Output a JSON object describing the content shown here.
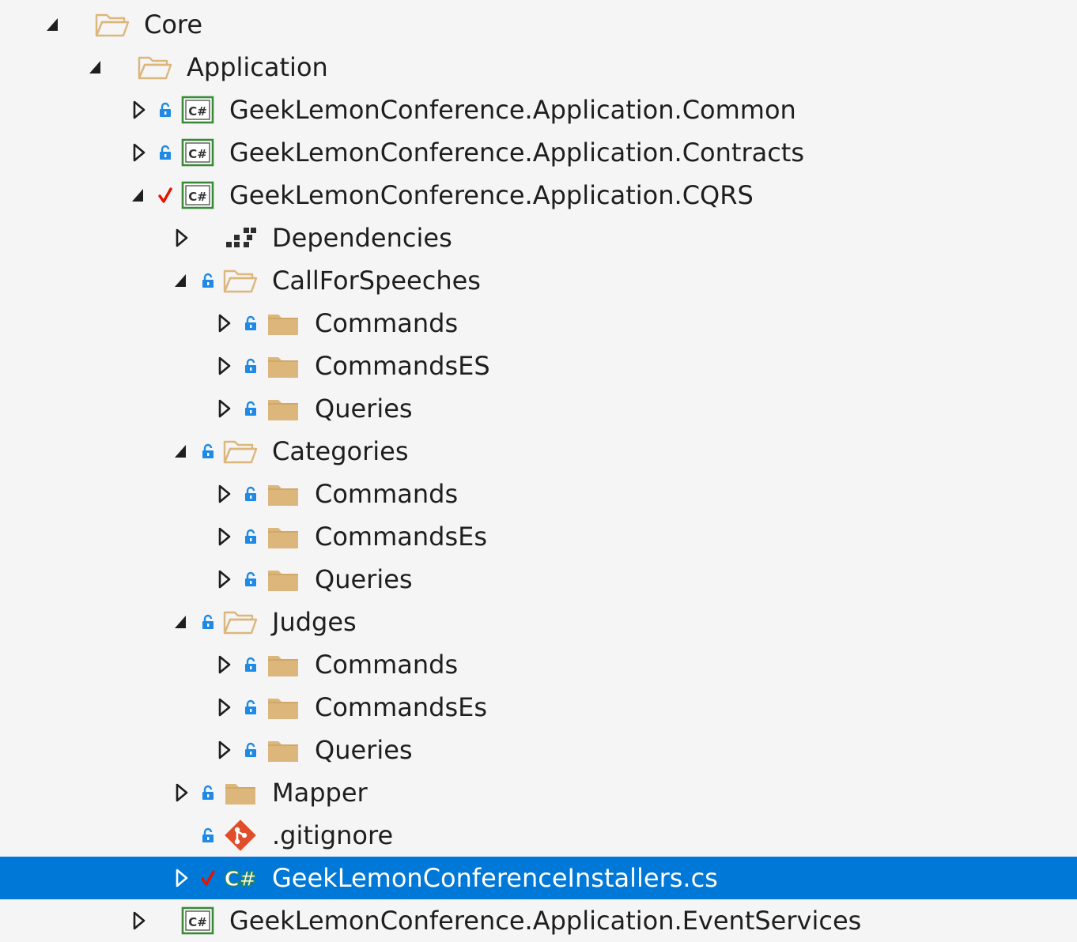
{
  "solution_explorer": {
    "rows": [
      {
        "label": "Core",
        "level": 0,
        "expander": "expanded",
        "status": "none",
        "icon": "folder-open-icon"
      },
      {
        "label": "Application",
        "level": 1,
        "expander": "expanded",
        "status": "none",
        "icon": "folder-open-icon"
      },
      {
        "label": "GeekLemonConference.Application.Common",
        "level": 2,
        "expander": "collapsed",
        "status": "lock",
        "icon": "csharp-project-icon"
      },
      {
        "label": "GeekLemonConference.Application.Contracts",
        "level": 2,
        "expander": "collapsed",
        "status": "lock",
        "icon": "csharp-project-icon"
      },
      {
        "label": "GeekLemonConference.Application.CQRS",
        "level": 2,
        "expander": "expanded",
        "status": "check",
        "icon": "csharp-project-icon"
      },
      {
        "label": "Dependencies",
        "level": 3,
        "expander": "collapsed",
        "status": "none",
        "icon": "dependencies-icon"
      },
      {
        "label": "CallForSpeeches",
        "level": 3,
        "expander": "expanded",
        "status": "lock",
        "icon": "folder-open-icon"
      },
      {
        "label": "Commands",
        "level": 4,
        "expander": "collapsed",
        "status": "lock",
        "icon": "folder-icon"
      },
      {
        "label": "CommandsES",
        "level": 4,
        "expander": "collapsed",
        "status": "lock",
        "icon": "folder-icon"
      },
      {
        "label": "Queries",
        "level": 4,
        "expander": "collapsed",
        "status": "lock",
        "icon": "folder-icon"
      },
      {
        "label": "Categories",
        "level": 3,
        "expander": "expanded",
        "status": "lock",
        "icon": "folder-open-icon"
      },
      {
        "label": "Commands",
        "level": 4,
        "expander": "collapsed",
        "status": "lock",
        "icon": "folder-icon"
      },
      {
        "label": "CommandsEs",
        "level": 4,
        "expander": "collapsed",
        "status": "lock",
        "icon": "folder-icon"
      },
      {
        "label": "Queries",
        "level": 4,
        "expander": "collapsed",
        "status": "lock",
        "icon": "folder-icon"
      },
      {
        "label": "Judges",
        "level": 3,
        "expander": "expanded",
        "status": "lock",
        "icon": "folder-open-icon"
      },
      {
        "label": "Commands",
        "level": 4,
        "expander": "collapsed",
        "status": "lock",
        "icon": "folder-icon"
      },
      {
        "label": "CommandsEs",
        "level": 4,
        "expander": "collapsed",
        "status": "lock",
        "icon": "folder-icon"
      },
      {
        "label": "Queries",
        "level": 4,
        "expander": "collapsed",
        "status": "lock",
        "icon": "folder-icon"
      },
      {
        "label": "Mapper",
        "level": 3,
        "expander": "collapsed",
        "status": "lock",
        "icon": "folder-icon"
      },
      {
        "label": ".gitignore",
        "level": 3,
        "expander": "none",
        "status": "lock",
        "icon": "git-icon"
      },
      {
        "label": "GeekLemonConferenceInstallers.cs",
        "level": 3,
        "expander": "collapsed",
        "status": "check",
        "icon": "csharp-file-icon",
        "selected": true
      },
      {
        "label": "GeekLemonConference.Application.EventServices",
        "level": 2,
        "expander": "collapsed",
        "status": "none",
        "icon": "csharp-project-icon"
      }
    ],
    "colors": {
      "background": "#f5f5f5",
      "selection": "#0078d7",
      "folder": "#dcb67a",
      "lock": "#1e8ae6",
      "check": "#e51400",
      "csharp": "#388a34"
    }
  }
}
